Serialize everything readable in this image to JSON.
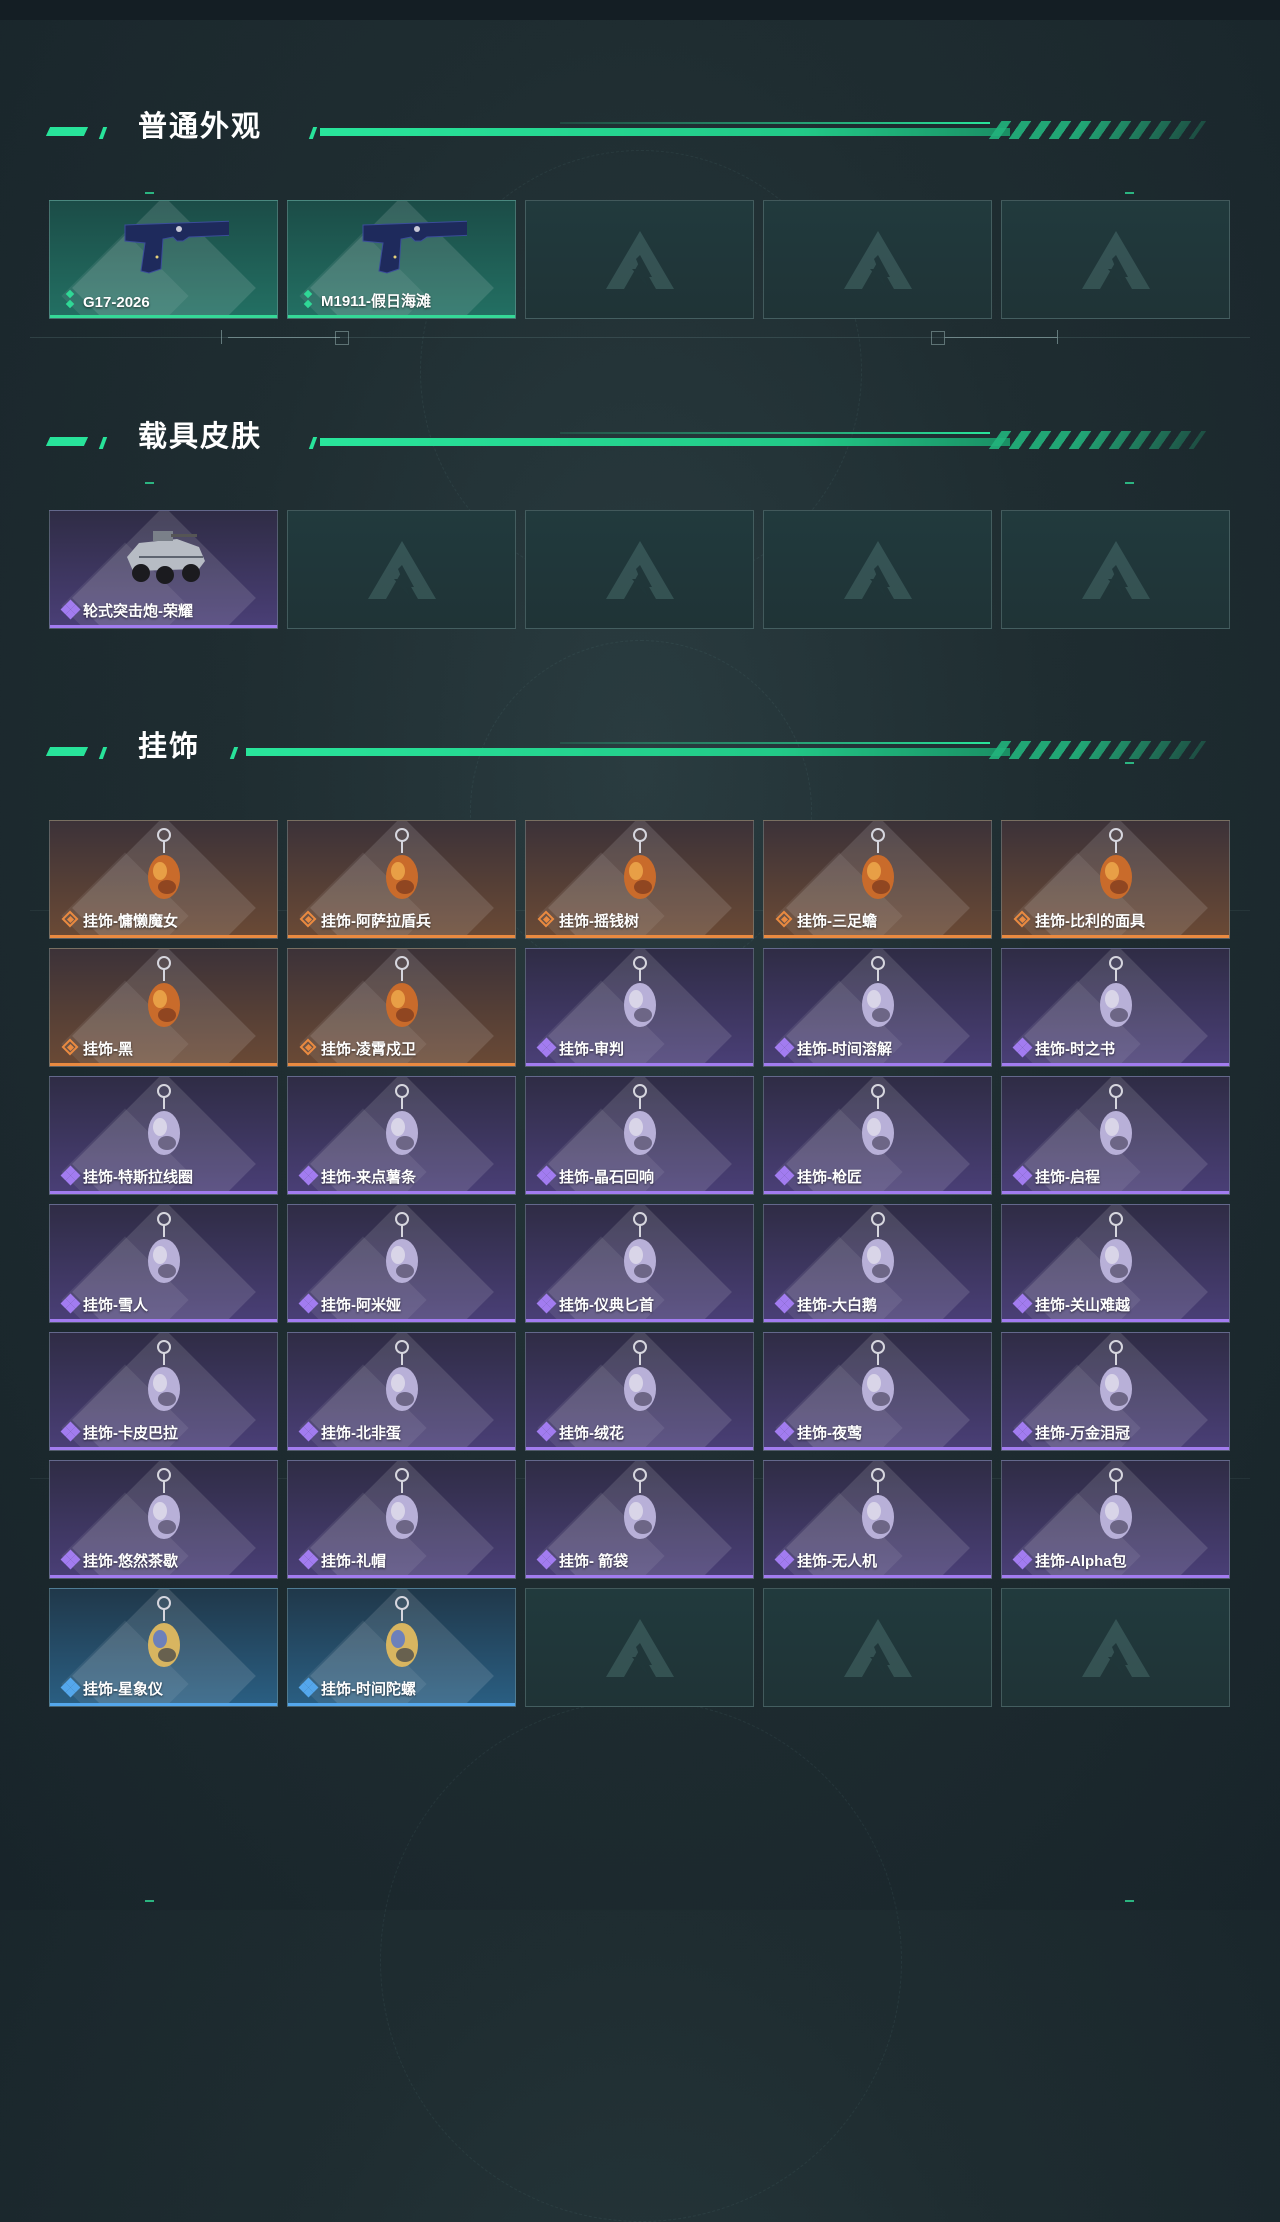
{
  "sections": [
    {
      "title": "普通外观",
      "items": [
        {
          "label": "G17-2026",
          "rarity": "green",
          "icon": "pistol-icon"
        },
        {
          "label": "M1911-假日海滩",
          "rarity": "green",
          "icon": "pistol-icon"
        },
        {
          "label": "",
          "rarity": "empty"
        },
        {
          "label": "",
          "rarity": "empty"
        },
        {
          "label": "",
          "rarity": "empty"
        }
      ]
    },
    {
      "title": "载具皮肤",
      "items": [
        {
          "label": "轮式突击炮-荣耀",
          "rarity": "purple",
          "icon": "vehicle-icon"
        },
        {
          "label": "",
          "rarity": "empty"
        },
        {
          "label": "",
          "rarity": "empty"
        },
        {
          "label": "",
          "rarity": "empty"
        },
        {
          "label": "",
          "rarity": "empty"
        }
      ]
    },
    {
      "title": "挂饰",
      "items": [
        {
          "label": "挂饰-慵懒魔女",
          "rarity": "orange",
          "icon": "witch-charm-icon"
        },
        {
          "label": "挂饰-阿萨拉盾兵",
          "rarity": "orange",
          "icon": "shield-soldier-charm-icon"
        },
        {
          "label": "挂饰-摇钱树",
          "rarity": "orange",
          "icon": "money-tree-charm-icon"
        },
        {
          "label": "挂饰-三足蟾",
          "rarity": "orange",
          "icon": "toad-charm-icon"
        },
        {
          "label": "挂饰-比利的面具",
          "rarity": "orange",
          "icon": "mask-charm-icon"
        },
        {
          "label": "挂饰-黑",
          "rarity": "orange",
          "icon": "tag-charm-icon"
        },
        {
          "label": "挂饰-凌霄戍卫",
          "rarity": "orange",
          "icon": "guard-charm-icon"
        },
        {
          "label": "挂饰-审判",
          "rarity": "purple",
          "icon": "card-charm-icon"
        },
        {
          "label": "挂饰-时间溶解",
          "rarity": "purple",
          "icon": "clock-charm-icon"
        },
        {
          "label": "挂饰-时之书",
          "rarity": "purple",
          "icon": "book-charm-icon"
        },
        {
          "label": "挂饰-特斯拉线圈",
          "rarity": "purple",
          "icon": "coil-charm-icon"
        },
        {
          "label": "挂饰-来点薯条",
          "rarity": "purple",
          "icon": "fries-charm-icon"
        },
        {
          "label": "挂饰-晶石回响",
          "rarity": "purple",
          "icon": "crystal-charm-icon"
        },
        {
          "label": "挂饰-枪匠",
          "rarity": "purple",
          "icon": "gunsmith-charm-icon"
        },
        {
          "label": "挂饰-启程",
          "rarity": "purple",
          "icon": "badge-charm-icon"
        },
        {
          "label": "挂饰-雪人",
          "rarity": "purple",
          "icon": "snowman-charm-icon"
        },
        {
          "label": "挂饰-阿米娅",
          "rarity": "purple",
          "icon": "bunny-charm-icon"
        },
        {
          "label": "挂饰-仪典匕首",
          "rarity": "purple",
          "icon": "dagger-charm-icon"
        },
        {
          "label": "挂饰-大白鹅",
          "rarity": "purple",
          "icon": "goose-charm-icon"
        },
        {
          "label": "挂饰-关山难越",
          "rarity": "purple",
          "icon": "scroll-charm-icon"
        },
        {
          "label": "挂饰-卡皮巴拉",
          "rarity": "purple",
          "icon": "capybara-charm-icon"
        },
        {
          "label": "挂饰-北非蛋",
          "rarity": "purple",
          "icon": "egg-pan-charm-icon"
        },
        {
          "label": "挂饰-绒花",
          "rarity": "purple",
          "icon": "flower-charm-icon"
        },
        {
          "label": "挂饰-夜莺",
          "rarity": "purple",
          "icon": "feather-charm-icon"
        },
        {
          "label": "挂饰-万金泪冠",
          "rarity": "purple",
          "icon": "burger-charm-icon"
        },
        {
          "label": "挂饰-悠然茶歇",
          "rarity": "purple",
          "icon": "cupcake-charm-icon"
        },
        {
          "label": "挂饰-礼帽",
          "rarity": "purple",
          "icon": "hat-charm-icon"
        },
        {
          "label": "挂饰- 箭袋",
          "rarity": "purple",
          "icon": "quiver-charm-icon"
        },
        {
          "label": "挂饰-无人机",
          "rarity": "purple",
          "icon": "drone-charm-icon"
        },
        {
          "label": "挂饰-Alpha包",
          "rarity": "purple",
          "icon": "bag-charm-icon"
        },
        {
          "label": "挂饰-星象仪",
          "rarity": "blue",
          "icon": "astrolabe-charm-icon"
        },
        {
          "label": "挂饰-时间陀螺",
          "rarity": "blue",
          "icon": "spinner-charm-icon"
        },
        {
          "label": "",
          "rarity": "empty"
        },
        {
          "label": "",
          "rarity": "empty"
        },
        {
          "label": "",
          "rarity": "empty"
        }
      ]
    }
  ],
  "colors": {
    "accent": "#28e39a",
    "green": "#35d997",
    "purple": "#a27cf0",
    "orange": "#ea8a40",
    "blue": "#54a7ec"
  }
}
